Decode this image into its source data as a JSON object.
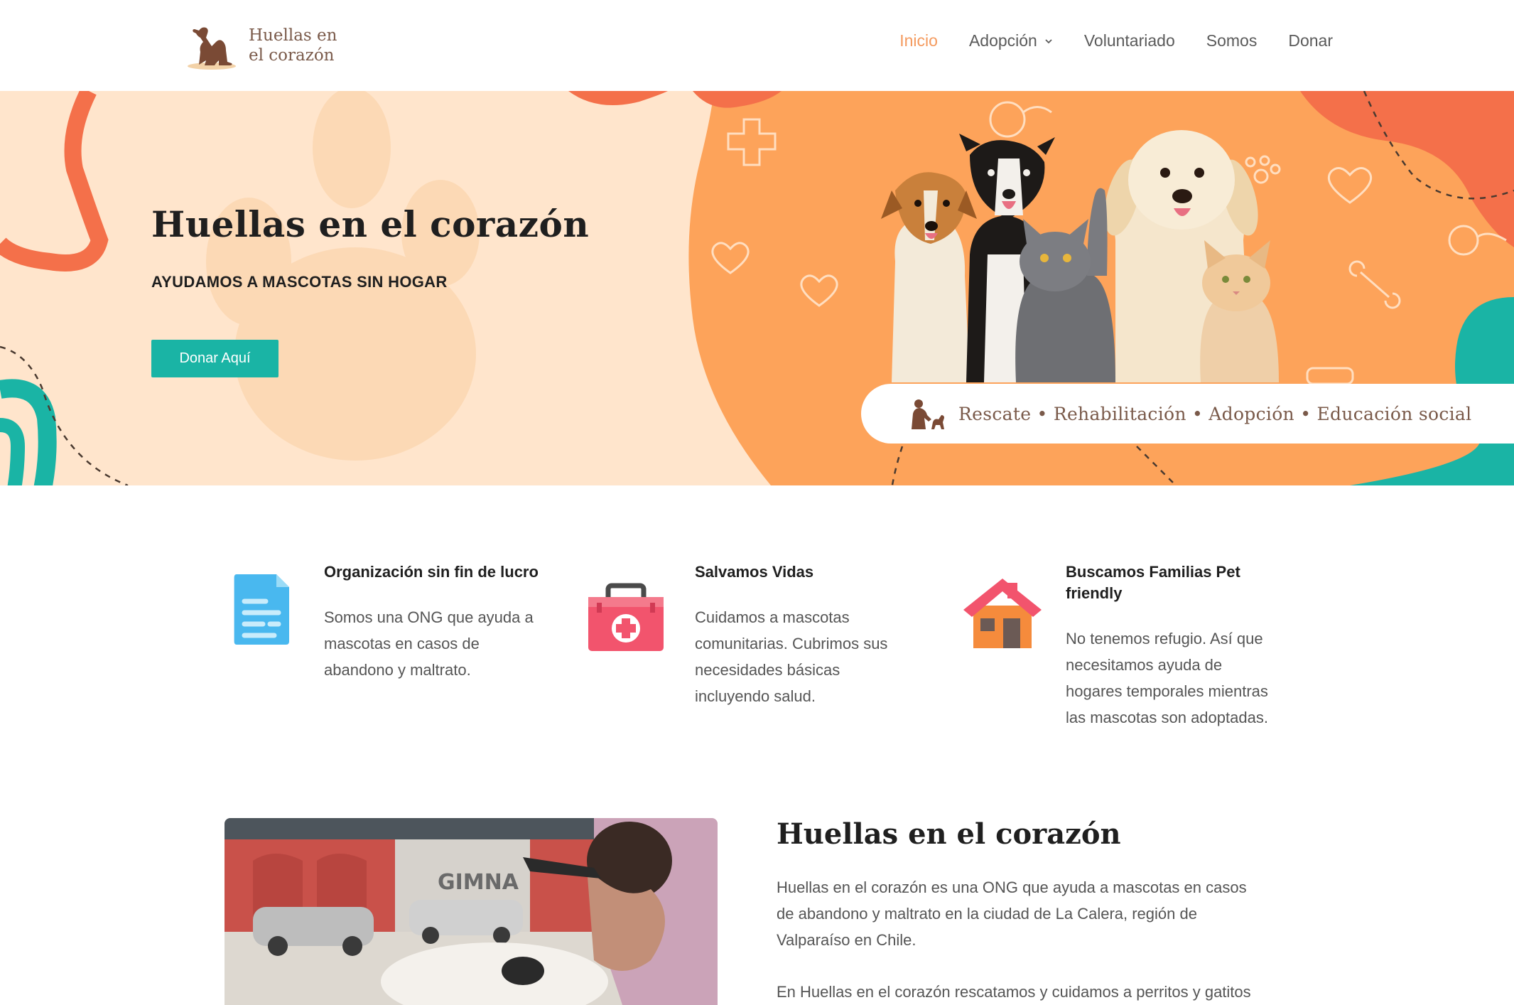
{
  "header": {
    "logo_line1": "Huellas en",
    "logo_line2": "el corazón",
    "nav": {
      "inicio": "Inicio",
      "adopcion": "Adopción",
      "voluntariado": "Voluntariado",
      "somos": "Somos",
      "donar": "Donar"
    }
  },
  "hero": {
    "title": "Huellas en el corazón",
    "subtitle": "AYUDAMOS A MASCOTAS SIN HOGAR",
    "button": "Donar Aquí",
    "pill_text": "Rescate • Rehabilitación • Adopción • Educación social"
  },
  "features": [
    {
      "title": "Organización sin fin de lucro",
      "lines": [
        "Somos una ONG que ayuda a",
        "mascotas en casos de",
        "abandono y maltrato."
      ],
      "icon": "document-icon"
    },
    {
      "title": "Salvamos Vidas",
      "lines": [
        "Cuidamos a mascotas",
        "comunitarias. Cubrimos sus",
        "necesidades básicas",
        "incluyendo salud."
      ],
      "icon": "first-aid-kit-icon"
    },
    {
      "title_line1": "Buscamos Familias Pet",
      "title_line2": "friendly",
      "lines": [
        "No tenemos refugio. Así que",
        "necesitamos ayuda de",
        "hogares temporales mientras",
        "las mascotas son adoptadas."
      ],
      "icon": "house-icon"
    }
  ],
  "about": {
    "title": "Huellas en el corazón",
    "p1_lines": [
      "Huellas en el corazón es una ONG que ayuda a mascotas en casos",
      "de abandono y maltrato en la ciudad de La Calera, región de",
      "Valparaíso en Chile."
    ],
    "p2": "En Huellas en el corazón rescatamos y cuidamos a perritos y gatitos",
    "photo_sign": "GIMNA"
  },
  "colors": {
    "accent_orange": "#f49a5e",
    "hero_bg": "#ffe5cc",
    "hero_orange": "#fda35a",
    "coral": "#f4704a",
    "teal": "#1ab4a5",
    "text_dark": "#1f1f1f"
  }
}
